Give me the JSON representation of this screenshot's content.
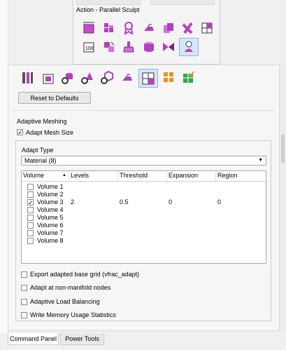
{
  "popup": {
    "title": "Action - Parallel Sculpt",
    "icons": [
      "box-select-icon",
      "grid-blocks-icon",
      "ribbon-award-icon",
      "iron-icon",
      "copy-pages-icon",
      "cross-x-icon",
      "quad-grid-icon",
      "numbered-box-icon",
      "box-arrows-icon",
      "broom-icon",
      "cylinder-layers-icon",
      "bow-tie-icon",
      "person-bust-icon"
    ],
    "selected_icon": "person-bust-icon"
  },
  "toolbar": {
    "icons": [
      "column-bars-icon",
      "box-select-icon",
      "cylinder-gear-icon",
      "cone-gear-icon",
      "hexagon-gear-icon",
      "iron-icon",
      "adapt-grid-icon",
      "orange-grid-icon",
      "green-grid-check-icon"
    ],
    "selected_icon": "adapt-grid-icon",
    "reset_label": "Reset to Defaults"
  },
  "adaptive": {
    "section_title": "Adaptive Meshing",
    "adapt_mesh_size_label": "Adapt Mesh Size",
    "adapt_mesh_size_checked": true,
    "adapt_type_label": "Adapt Type",
    "adapt_type_value": "Material (8)",
    "table": {
      "headers": [
        "Volume",
        "Levels",
        "Threshold",
        "Expansion",
        "Region"
      ],
      "rows": [
        {
          "name": "Volume 1",
          "checked": false,
          "levels": "",
          "threshold": "",
          "expansion": "",
          "region": ""
        },
        {
          "name": "Volume 2",
          "checked": false,
          "levels": "",
          "threshold": "",
          "expansion": "",
          "region": ""
        },
        {
          "name": "Volume 3",
          "checked": true,
          "levels": "2",
          "threshold": "0.5",
          "expansion": "0",
          "region": "0"
        },
        {
          "name": "Volume 4",
          "checked": false,
          "levels": "",
          "threshold": "",
          "expansion": "",
          "region": ""
        },
        {
          "name": "Volume 5",
          "checked": false,
          "levels": "",
          "threshold": "",
          "expansion": "",
          "region": ""
        },
        {
          "name": "Volume 6",
          "checked": false,
          "levels": "",
          "threshold": "",
          "expansion": "",
          "region": ""
        },
        {
          "name": "Volume 7",
          "checked": false,
          "levels": "",
          "threshold": "",
          "expansion": "",
          "region": ""
        },
        {
          "name": "Volume 8",
          "checked": false,
          "levels": "",
          "threshold": "",
          "expansion": "",
          "region": ""
        }
      ]
    },
    "options": [
      {
        "label": "Export adapted base grid (vfrac_adapt)",
        "checked": false
      },
      {
        "label": "Adapt at non-manifold nodes",
        "checked": false
      },
      {
        "label": "Adaptive Load Balancing",
        "checked": false
      },
      {
        "label": "Write Memory Usage Statistics",
        "checked": false
      }
    ]
  },
  "tabs": [
    {
      "label": "Command Panel",
      "active": true
    },
    {
      "label": "Power Tools",
      "active": false
    }
  ],
  "colors": {
    "accent": "#b000b0",
    "selected_bg": "#d7e6f7",
    "icon_purple": "#9b2fae",
    "icon_orange": "#e69422",
    "icon_green": "#2fa84f"
  }
}
